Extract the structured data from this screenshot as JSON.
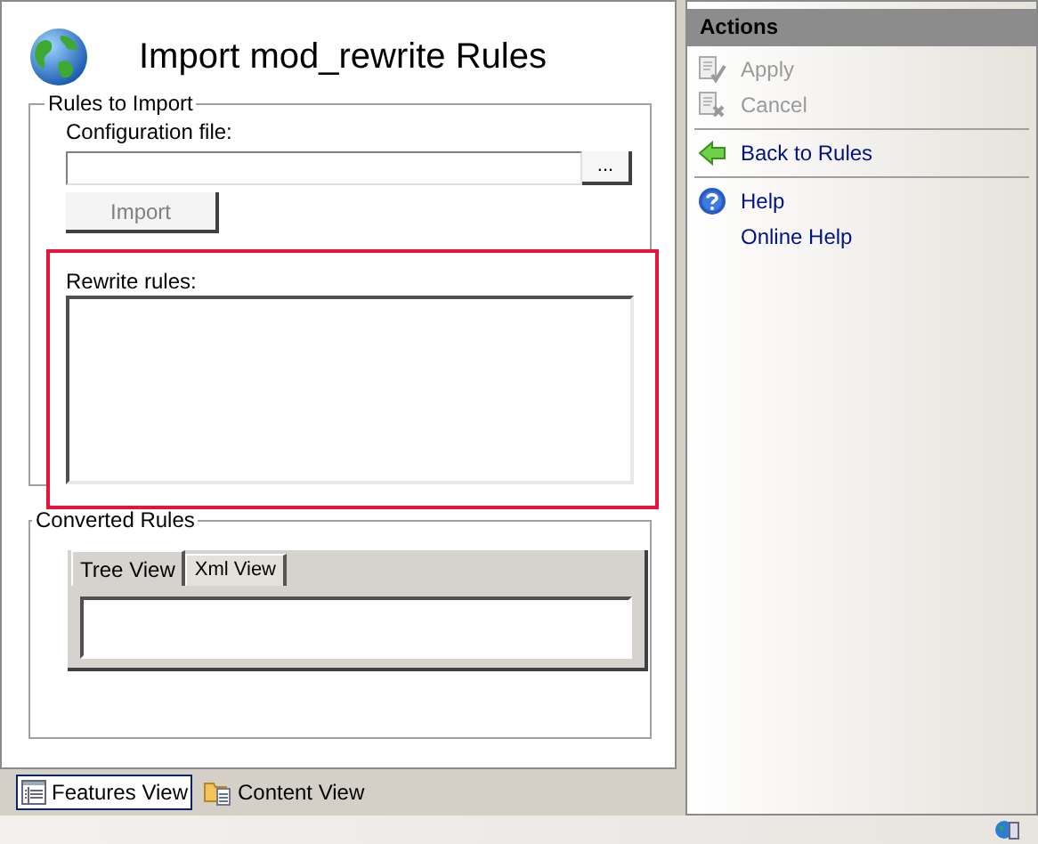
{
  "page": {
    "title": "Import mod_rewrite Rules"
  },
  "rules_to_import": {
    "legend": "Rules to Import",
    "config_label": "Configuration file:",
    "browse_button": "...",
    "import_button": "Import",
    "import_disabled": true,
    "rewrite_label": "Rewrite rules:"
  },
  "converted_rules": {
    "legend": "Converted Rules",
    "tabs": [
      {
        "label": "Tree View",
        "selected": true
      },
      {
        "label": "Xml View",
        "selected": false
      }
    ]
  },
  "view_tabs": [
    {
      "label": "Features View",
      "kind": "features",
      "selected": true
    },
    {
      "label": "Content View",
      "kind": "content",
      "selected": false
    }
  ],
  "actions": {
    "title": "Actions",
    "groups": [
      {
        "items": [
          {
            "label": "Apply",
            "kind": "apply",
            "disabled": true
          },
          {
            "label": "Cancel",
            "kind": "cancel",
            "disabled": true
          }
        ]
      },
      {
        "items": [
          {
            "label": "Back to Rules",
            "kind": "back",
            "disabled": false
          }
        ]
      },
      {
        "items": [
          {
            "label": "Help",
            "kind": "help",
            "disabled": false
          },
          {
            "label": "Online Help",
            "kind": "plain",
            "disabled": false
          }
        ]
      }
    ]
  }
}
